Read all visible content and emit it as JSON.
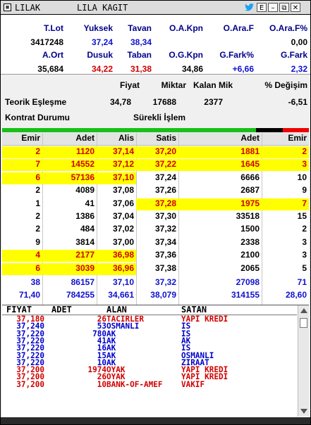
{
  "window": {
    "symbol": "LILAK",
    "name": "LILA KAGIT",
    "buttons": [
      "E",
      "–",
      "⧉",
      "✕"
    ]
  },
  "summary": {
    "row1_labels": [
      "T.Lot",
      "Yuksek",
      "Tavan",
      "O.A.Kpn",
      "O.Ara.F",
      "O.Ara.F%"
    ],
    "row1_values": [
      "3417248",
      "37,24",
      "38,34",
      "",
      "",
      "0,00"
    ],
    "row2_labels": [
      "A.Ort",
      "Dusuk",
      "Taban",
      "O.G.Kpn",
      "G.Fark%",
      "G.Fark"
    ],
    "row2_values": [
      "35,684",
      "34,22",
      "31,38",
      "34,86",
      "+6,66",
      "2,32"
    ],
    "colors": {
      "label": "#00008b",
      "value": "#000000",
      "dusuk": "#d00000",
      "taban": "#d00000",
      "tavan": "#1010d0",
      "up": "#1010d0",
      "gfark": "#1010d0"
    }
  },
  "theoretical": {
    "headers": [
      "Fiyat",
      "Miktar",
      "Kalan Mik",
      "% Değişim"
    ],
    "row_label": "Teorik Eşleşme",
    "values": [
      "34,78",
      "17688",
      "2377",
      "-6,51"
    ],
    "contract_label": "Kontrat Durumu",
    "contract_value": "Sürekli İşlem"
  },
  "book": {
    "headers": [
      "Emir",
      "Adet",
      "Alis",
      "Satis",
      "Adet",
      "Emir"
    ],
    "rows": [
      [
        "2",
        "1120",
        "37,14",
        "37,20",
        "1881",
        "2"
      ],
      [
        "7",
        "14552",
        "37,12",
        "37,22",
        "1645",
        "3"
      ],
      [
        "6",
        "57136",
        "37,10",
        "37,24",
        "6666",
        "10"
      ],
      [
        "2",
        "4089",
        "37,08",
        "37,26",
        "2687",
        "9"
      ],
      [
        "1",
        "41",
        "37,06",
        "37,28",
        "1975",
        "7"
      ],
      [
        "2",
        "1386",
        "37,04",
        "37,30",
        "33518",
        "15"
      ],
      [
        "2",
        "484",
        "37,02",
        "37,32",
        "1500",
        "2"
      ],
      [
        "9",
        "3814",
        "37,00",
        "37,34",
        "2338",
        "3"
      ],
      [
        "4",
        "2177",
        "36,98",
        "37,36",
        "2100",
        "3"
      ],
      [
        "6",
        "3039",
        "36,96",
        "37,38",
        "2065",
        "5"
      ]
    ],
    "highlight": [
      [
        true,
        true,
        true,
        true,
        true,
        true
      ],
      [
        true,
        true,
        true,
        true,
        true,
        true
      ],
      [
        true,
        true,
        true,
        false,
        false,
        false
      ],
      [
        false,
        false,
        false,
        false,
        false,
        false
      ],
      [
        false,
        false,
        false,
        true,
        true,
        true
      ],
      [
        false,
        false,
        false,
        false,
        false,
        false
      ],
      [
        false,
        false,
        false,
        false,
        false,
        false
      ],
      [
        false,
        false,
        false,
        false,
        false,
        false
      ],
      [
        true,
        true,
        true,
        false,
        false,
        false
      ],
      [
        true,
        true,
        true,
        false,
        false,
        false
      ]
    ],
    "totals": [
      [
        "38",
        "86157",
        "37,10",
        "37,32",
        "27098",
        "71"
      ],
      [
        "71,40",
        "784255",
        "34,661",
        "38,079",
        "314155",
        "28,60"
      ]
    ],
    "totals_color": "#1010d0",
    "highlight_bg": "#ffff00",
    "highlight_fg": "#d00000"
  },
  "trades": {
    "headers": [
      "FIYAT",
      "ADET",
      "ALAN",
      "SATAN"
    ],
    "rows": [
      [
        "37,180",
        "26",
        "TACIRLER",
        "YAPI KREDI",
        "red"
      ],
      [
        "37,240",
        "53",
        "OSMANLI",
        "IS",
        "blue"
      ],
      [
        "37,220",
        "780",
        "AK",
        "IS",
        "blue"
      ],
      [
        "37,220",
        "41",
        "AK",
        "AK",
        "blue"
      ],
      [
        "37,220",
        "16",
        "AK",
        "IS",
        "blue"
      ],
      [
        "37,220",
        "15",
        "AK",
        "OSMANLI",
        "blue"
      ],
      [
        "37,220",
        "10",
        "AK",
        "ZIRAAT",
        "blue"
      ],
      [
        "37,200",
        "1974",
        "OYAK",
        "YAPI KREDI",
        "red"
      ],
      [
        "37,200",
        "26",
        "OYAK",
        "YAPI KREDI",
        "red"
      ],
      [
        "37,200",
        "10",
        "BANK-OF-AMEF",
        "VAKIF",
        "red"
      ]
    ],
    "colors": {
      "red": "#d00000",
      "blue": "#0000c8"
    }
  }
}
